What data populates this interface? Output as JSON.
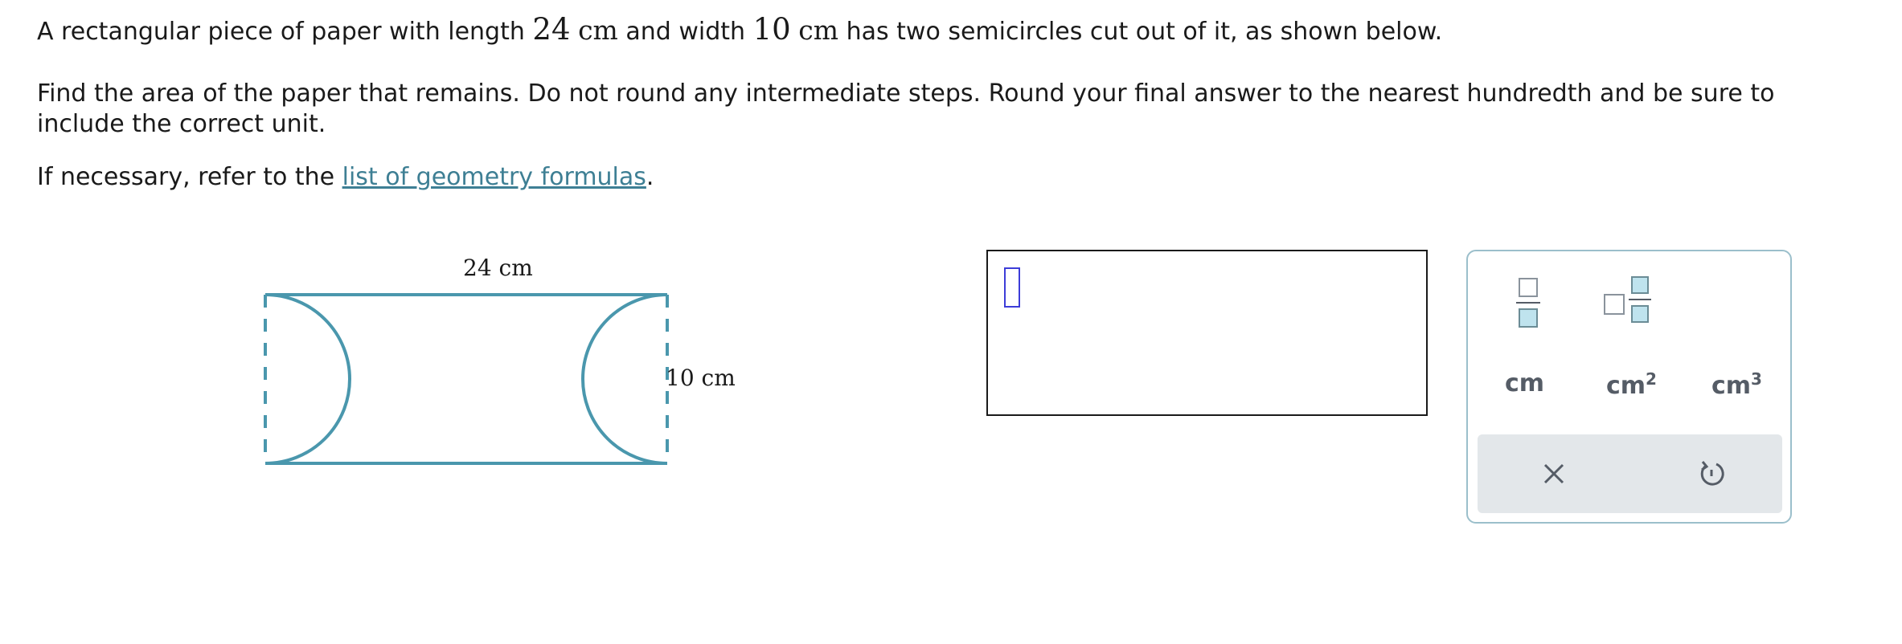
{
  "question": {
    "p1_a": "A rectangular piece of paper with length",
    "length_value": "24",
    "length_unit": "cm",
    "p1_b": "and width",
    "width_value": "10",
    "width_unit": "cm",
    "p1_c": "has two semicircles cut out of it, as shown below.",
    "p2_line1": "Find the area of the paper that remains. Do not round any intermediate steps. Round your final answer to the nearest hundredth and be sure to",
    "p2_line2": "include the correct unit.",
    "p3_prefix": "If necessary, refer to the",
    "p3_link": "list of geometry formulas",
    "p3_suffix": "."
  },
  "figure": {
    "length_label": "24 cm",
    "width_label": "10 cm",
    "stroke_color": "#4a97ad"
  },
  "answer": {
    "value": ""
  },
  "palette": {
    "units": {
      "cm": "cm",
      "cm2_base": "cm",
      "cm2_exp": "2",
      "cm3_base": "cm",
      "cm3_exp": "3"
    },
    "icons": [
      "fraction-icon",
      "mixed-number-icon",
      "clear-icon",
      "undo-icon"
    ]
  },
  "colors": {
    "link": "#3e7f94",
    "accent": "#4a97ad",
    "cursor": "#3d3dd8"
  }
}
